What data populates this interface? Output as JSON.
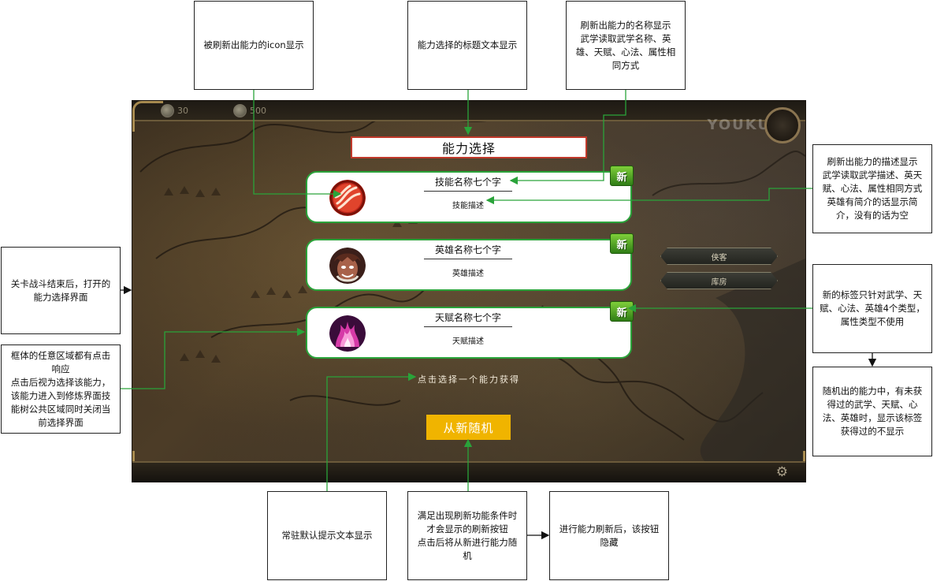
{
  "game": {
    "resource1": "30",
    "resource2": "500",
    "watermark": "YOUKU",
    "title": "能力选择",
    "cards": [
      {
        "name": "技能名称七个字",
        "desc": "技能描述",
        "badge": "新",
        "icon": "skill-flame-icon"
      },
      {
        "name": "英雄名称七个字",
        "desc": "英雄描述",
        "badge": "新",
        "icon": "hero-portrait-icon"
      },
      {
        "name": "天赋名称七个字",
        "desc": "天赋描述",
        "badge": "新",
        "icon": "talent-fire-icon"
      }
    ],
    "side_buttons": [
      "侠客",
      "库房"
    ],
    "hint": "点击选择一个能力获得",
    "reroll_label": "从新随机"
  },
  "annotations": {
    "icon_note": "被刷新出能力的icon显示",
    "title_note": "能力选择的标题文本显示",
    "name_note": "刷新出能力的名称显示\n武学读取武学名称、英雄、天赋、心法、属性相同方式",
    "desc_note": "刷新出能力的描述显示\n武学读取武学描述、英天赋、心法、属性相同方式\n英雄有简介的话显示简介，没有的话为空",
    "open_note": "关卡战斗结束后，打开的能力选择界面",
    "badge_note": "新的标签只针对武学、天赋、心法、英雄4个类型，属性类型不使用",
    "badge_note2": "随机出的能力中，有未获得过的武学、天赋、心法、英雄时，显示该标签\n获得过的不显示",
    "click_note": "框体的任意区域都有点击响应\n点击后视为选择该能力，该能力进入到修炼界面技能树公共区域同时关闭当前选择界面",
    "hint_note": "常驻默认提示文本显示",
    "reroll_note": "满足出现刷新功能条件时才会显示的刷新按钮\n点击后将从新进行能力随机",
    "hide_note": "进行能力刷新后，该按钮隐藏"
  },
  "colors": {
    "card_border": "#2aa33a",
    "title_border": "#c0392b",
    "reroll_bg": "#f0b400",
    "badge_green": "#4fa625",
    "arrow_green": "#2aa33a"
  }
}
